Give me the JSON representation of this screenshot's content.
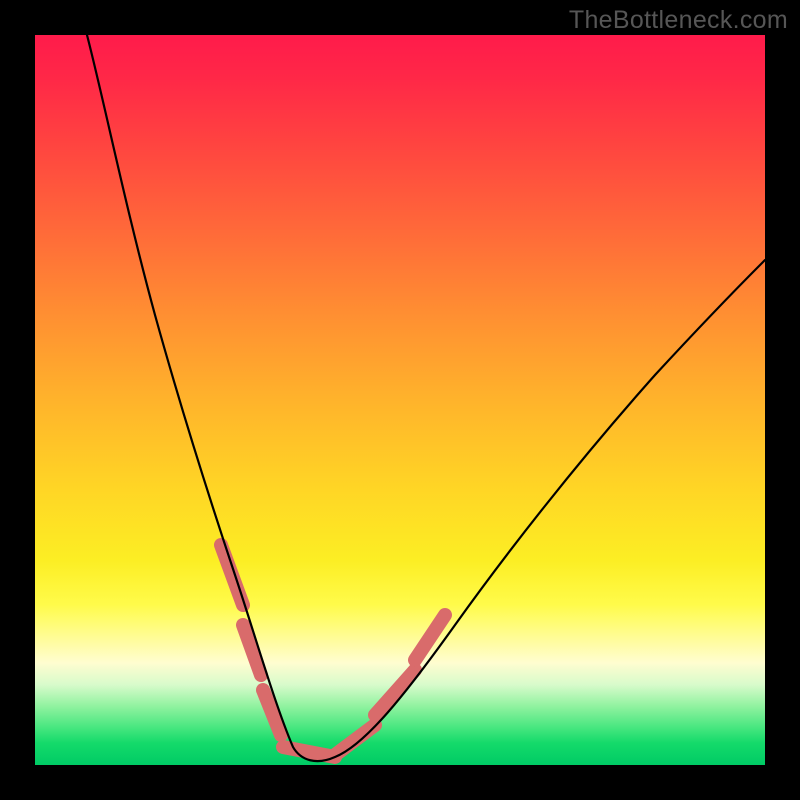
{
  "watermark": "TheBottleneck.com",
  "chart_data": {
    "type": "line",
    "title": "",
    "xlabel": "",
    "ylabel": "",
    "xlim": [
      0,
      100
    ],
    "ylim": [
      0,
      100
    ],
    "axes_visible": false,
    "grid": false,
    "background": {
      "type": "vertical-gradient",
      "stops": [
        {
          "pos": 0,
          "color": "#ff1b4b"
        },
        {
          "pos": 50,
          "color": "#ffb32b"
        },
        {
          "pos": 80,
          "color": "#fffb4a"
        },
        {
          "pos": 100,
          "color": "#00cb65"
        }
      ],
      "note": "gradient encodes bottleneck severity: red=high, green=low"
    },
    "series": [
      {
        "name": "bottleneck-curve",
        "note": "V-shaped curve; y is severity (0 at floor) vs an unlabeled x configuration axis; values estimated from pixel positions, no axis ticks shown",
        "x": [
          7,
          10,
          13,
          16,
          19,
          22,
          25,
          27,
          29,
          31,
          33,
          34.5,
          36,
          38,
          40,
          44,
          50,
          56,
          62,
          70,
          80,
          90,
          100
        ],
        "y": [
          100,
          86,
          73,
          61,
          50,
          40,
          30,
          23,
          17,
          11,
          6,
          2,
          0,
          0,
          2,
          7,
          14,
          22,
          30,
          40,
          52,
          62,
          72
        ]
      }
    ],
    "annotations": [
      {
        "name": "highlight-segments",
        "note": "thicker salmon segments overlaid near the curve minimum on both descending and ascending arms",
        "color": "#d96b6b"
      }
    ]
  }
}
